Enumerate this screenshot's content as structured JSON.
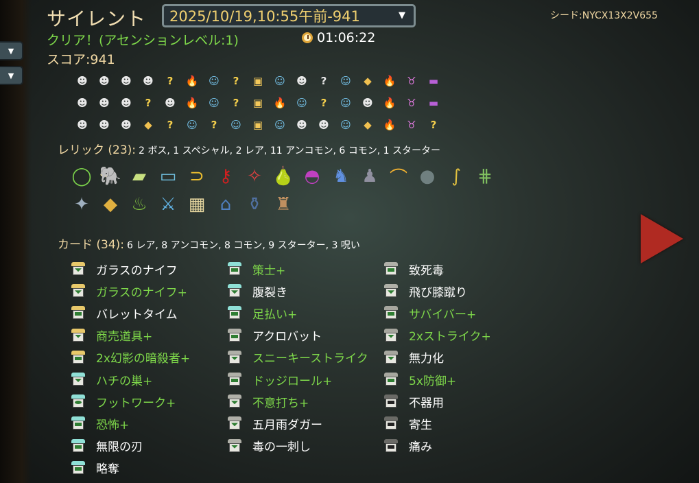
{
  "header": {
    "character": "サイレント",
    "run_select": "2025/10/19,10:55午前-941",
    "seed": "シード:NYCX13X2V655",
    "result": "クリア！(アセンションレベル:1)",
    "time": "01:06:22",
    "score": "スコア:941"
  },
  "path_rows": [
    [
      "monster",
      "monster",
      "monster",
      "monster",
      "unknown",
      "rest",
      "shop",
      "unknown",
      "treasure",
      "shop",
      "monster",
      "unknown-monster",
      "shop",
      "gold",
      "rest",
      "boss",
      "chest"
    ],
    [
      "monster",
      "monster",
      "monster",
      "unknown",
      "monster",
      "rest",
      "shop",
      "unknown",
      "treasure",
      "rest",
      "shop",
      "unknown",
      "shop",
      "monster",
      "rest",
      "boss",
      "chest"
    ],
    [
      "monster",
      "monster",
      "monster",
      "gold",
      "unknown-treasure",
      "shop",
      "unknown",
      "shop",
      "treasure",
      "shop",
      "monster",
      "monster",
      "shop",
      "gold",
      "rest",
      "boss",
      "unknown"
    ]
  ],
  "relics_section": {
    "label": "レリック (23):",
    "summary": "2 ボス, 1 スペシャル, 2 レア, 11 アンコモン, 6 コモン, 1 スターター"
  },
  "relic_rows": [
    [
      "ring-relic",
      "elephant-relic",
      "ingot-relic",
      "ticket-relic",
      "horn-relic",
      "key-relic",
      "claw-relic",
      "pear-relic",
      "fan-relic",
      "bird-relic",
      "mouse-relic",
      "boomerang-relic",
      "kettlebell-relic",
      "cane-relic",
      "ladder-relic"
    ],
    [
      "shuriken-relic",
      "crystal-relic",
      "teapot-relic",
      "sword-relic",
      "bread-relic",
      "tiny-house-relic",
      "jar-relic",
      "backpack-relic"
    ]
  ],
  "cards_section": {
    "label": "カード (34):",
    "summary": "6 レア, 8 アンコモン, 8 コモン, 9 スターター, 3 呪い"
  },
  "card_columns": [
    [
      {
        "name": "ガラスのナイフ",
        "upgraded": false,
        "rarity": "rare",
        "type": "attack"
      },
      {
        "name": "ガラスのナイフ+",
        "upgraded": true,
        "rarity": "rare",
        "type": "attack"
      },
      {
        "name": "バレットタイム",
        "upgraded": false,
        "rarity": "rare",
        "type": "skill"
      },
      {
        "name": "商売道具+",
        "upgraded": true,
        "rarity": "rare",
        "type": "attack"
      },
      {
        "name": "2x幻影の暗殺者+",
        "upgraded": true,
        "rarity": "rare",
        "type": "skill"
      },
      {
        "name": "ハチの巣+",
        "upgraded": true,
        "rarity": "uncommon",
        "type": "attack"
      },
      {
        "name": "フットワーク+",
        "upgraded": true,
        "rarity": "uncommon",
        "type": "power"
      },
      {
        "name": "恐怖+",
        "upgraded": true,
        "rarity": "uncommon",
        "type": "skill"
      },
      {
        "name": "無限の刃",
        "upgraded": false,
        "rarity": "uncommon",
        "type": "skill"
      },
      {
        "name": "略奪",
        "upgraded": false,
        "rarity": "uncommon",
        "type": "skill"
      }
    ],
    [
      {
        "name": "策士+",
        "upgraded": true,
        "rarity": "uncommon",
        "type": "skill"
      },
      {
        "name": "腹裂き",
        "upgraded": false,
        "rarity": "uncommon",
        "type": "attack"
      },
      {
        "name": "足払い+",
        "upgraded": true,
        "rarity": "uncommon",
        "type": "skill"
      },
      {
        "name": "アクロバット",
        "upgraded": false,
        "rarity": "common",
        "type": "skill"
      },
      {
        "name": "スニーキーストライク",
        "upgraded": true,
        "rarity": "common",
        "type": "attack"
      },
      {
        "name": "ドッジロール+",
        "upgraded": true,
        "rarity": "common",
        "type": "skill"
      },
      {
        "name": "不意打ち+",
        "upgraded": true,
        "rarity": "common",
        "type": "attack"
      },
      {
        "name": "五月雨ダガー",
        "upgraded": false,
        "rarity": "common",
        "type": "attack"
      },
      {
        "name": "毒の一刺し",
        "upgraded": false,
        "rarity": "common",
        "type": "attack"
      }
    ],
    [
      {
        "name": "致死毒",
        "upgraded": false,
        "rarity": "common",
        "type": "skill"
      },
      {
        "name": "飛び膝蹴り",
        "upgraded": false,
        "rarity": "common",
        "type": "attack"
      },
      {
        "name": "サバイバー+",
        "upgraded": true,
        "rarity": "starter",
        "type": "skill"
      },
      {
        "name": "2xストライク+",
        "upgraded": true,
        "rarity": "starter",
        "type": "attack"
      },
      {
        "name": "無力化",
        "upgraded": false,
        "rarity": "starter",
        "type": "attack"
      },
      {
        "name": "5x防御+",
        "upgraded": true,
        "rarity": "starter",
        "type": "skill"
      },
      {
        "name": "不器用",
        "upgraded": false,
        "rarity": "curse",
        "type": "curse"
      },
      {
        "name": "寄生",
        "upgraded": false,
        "rarity": "curse",
        "type": "curse"
      },
      {
        "name": "痛み",
        "upgraded": false,
        "rarity": "curse",
        "type": "curse"
      }
    ]
  ],
  "colors": {
    "upgraded_text": "#7ed84a",
    "rare_top": "#e8c86a",
    "uncommon_top": "#8fe0d6",
    "common_top": "#b0b0a8",
    "starter_top": "#a6a69e",
    "curse_top": "#6a6a66"
  }
}
